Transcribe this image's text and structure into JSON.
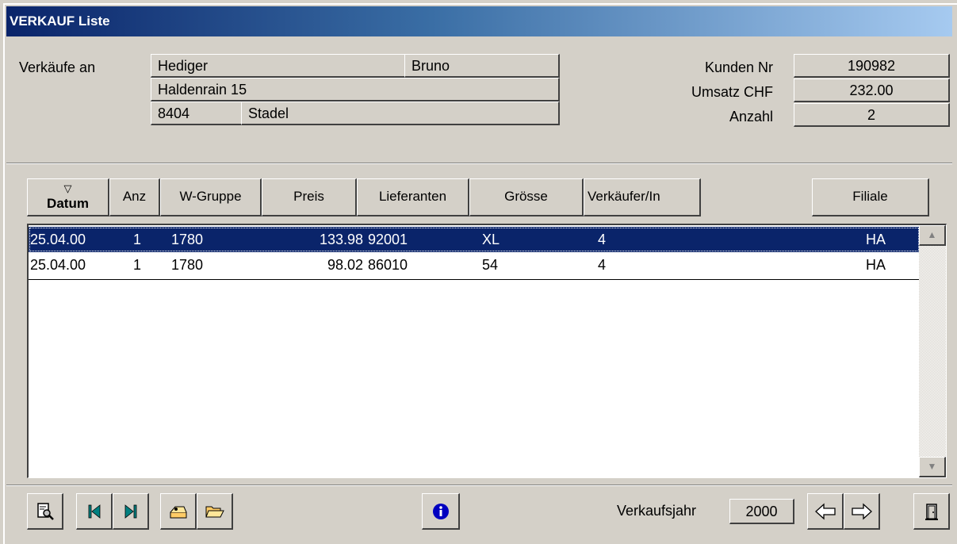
{
  "window": {
    "title": "VERKAUF Liste"
  },
  "customer": {
    "label": "Verkäufe an",
    "last_name": "Hediger",
    "first_name": "Bruno",
    "street": "Haldenrain 15",
    "zip": "8404",
    "city": "Stadel"
  },
  "summary": {
    "kunden_nr_label": "Kunden Nr",
    "kunden_nr": "190982",
    "umsatz_label": "Umsatz CHF",
    "umsatz": "232.00",
    "anzahl_label": "Anzahl",
    "anzahl": "2"
  },
  "table": {
    "columns": [
      "Datum",
      "Anz",
      "W-Gruppe",
      "Preis",
      "Lieferanten",
      "Grösse",
      "Verkäufer/In",
      "",
      "Filiale"
    ],
    "sorted_column": "Datum",
    "rows": [
      {
        "datum": "25.04.00",
        "anz": "1",
        "wgruppe": "1780",
        "preis": "133.98",
        "lieferant": "92001",
        "groesse": "XL",
        "verkaeufer": "4",
        "filiale": "HA",
        "selected": true
      },
      {
        "datum": "25.04.00",
        "anz": "1",
        "wgruppe": "1780",
        "preis": "98.02",
        "lieferant": "86010",
        "groesse": "54",
        "verkaeufer": "4",
        "filiale": "HA",
        "selected": false
      }
    ]
  },
  "toolbar": {
    "icons": [
      "preview-icon",
      "first-record-icon",
      "last-record-icon",
      "edit-icon",
      "open-folder-icon",
      "info-icon",
      "prev-year-icon",
      "next-year-icon",
      "exit-door-icon"
    ],
    "year_label": "Verkaufsjahr",
    "year": "2000"
  },
  "colors": {
    "title_start": "#0a246a",
    "title_end": "#a6caf0",
    "selection": "#0a246a",
    "face": "#d4d0c8",
    "icon_teal": "#008080",
    "info_blue": "#0000c0"
  }
}
